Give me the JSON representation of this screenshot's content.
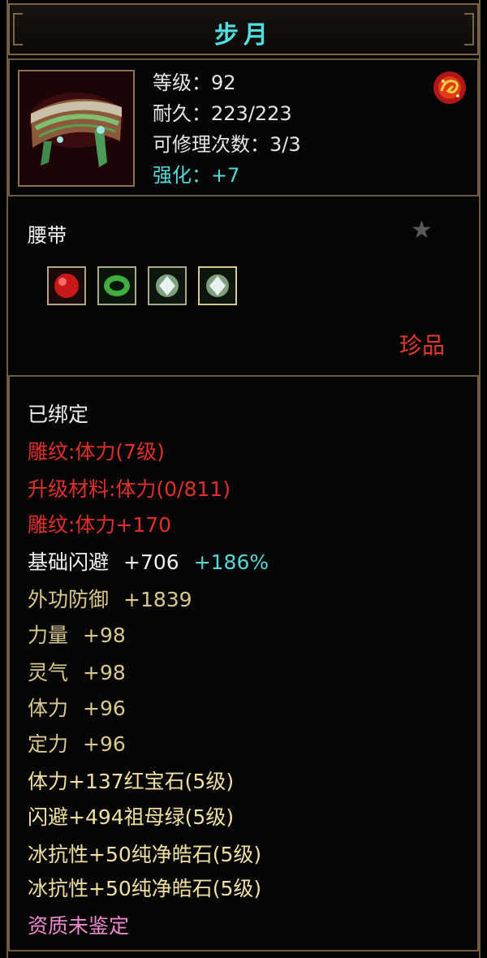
{
  "title": "步月",
  "info": {
    "level": "等级：92",
    "durability": "耐久：223/223",
    "repair": "可修理次数：3/3",
    "enhance": "强化：+7",
    "item_icon": "belt-icon",
    "badge_icon": "dragon-emblem-icon"
  },
  "item_type": "腰带",
  "star_icon": "star-icon",
  "gems": [
    "ruby-gem-icon",
    "emerald-gem-icon",
    "diamond-gem-icon",
    "diamond-gem-icon"
  ],
  "grade": "珍品",
  "attributes": {
    "bound": "已绑定",
    "engrave_level": "雕纹:体力(7级)",
    "upgrade_material": "升级材料:体力(0/811)",
    "engrave_bonus": "雕纹:体力+170",
    "dodge_label": "基础闪避",
    "dodge_value": "+706",
    "dodge_extra": "+186%",
    "defense_label": "外功防御",
    "defense_value": "+1839",
    "strength_label": "力量",
    "strength_value": "+98",
    "spirit_label": "灵气",
    "spirit_value": "+98",
    "stamina_label": "体力",
    "stamina_value": "+96",
    "focus_label": "定力",
    "focus_value": "+96",
    "gem1": "体力+137红宝石(5级)",
    "gem2": "闪避+494祖母绿(5级)",
    "gem3": "冰抗性+50纯净皓石(5级)",
    "gem4": "冰抗性+50纯净皓石(5级)",
    "aptitude": "资质未鉴定"
  },
  "colors": {
    "title": "#4ee0e0",
    "red_text": "#e0302a",
    "gold_text": "#d9c98c",
    "pink_text": "#f08ad0",
    "border": "#6e5a3e"
  }
}
